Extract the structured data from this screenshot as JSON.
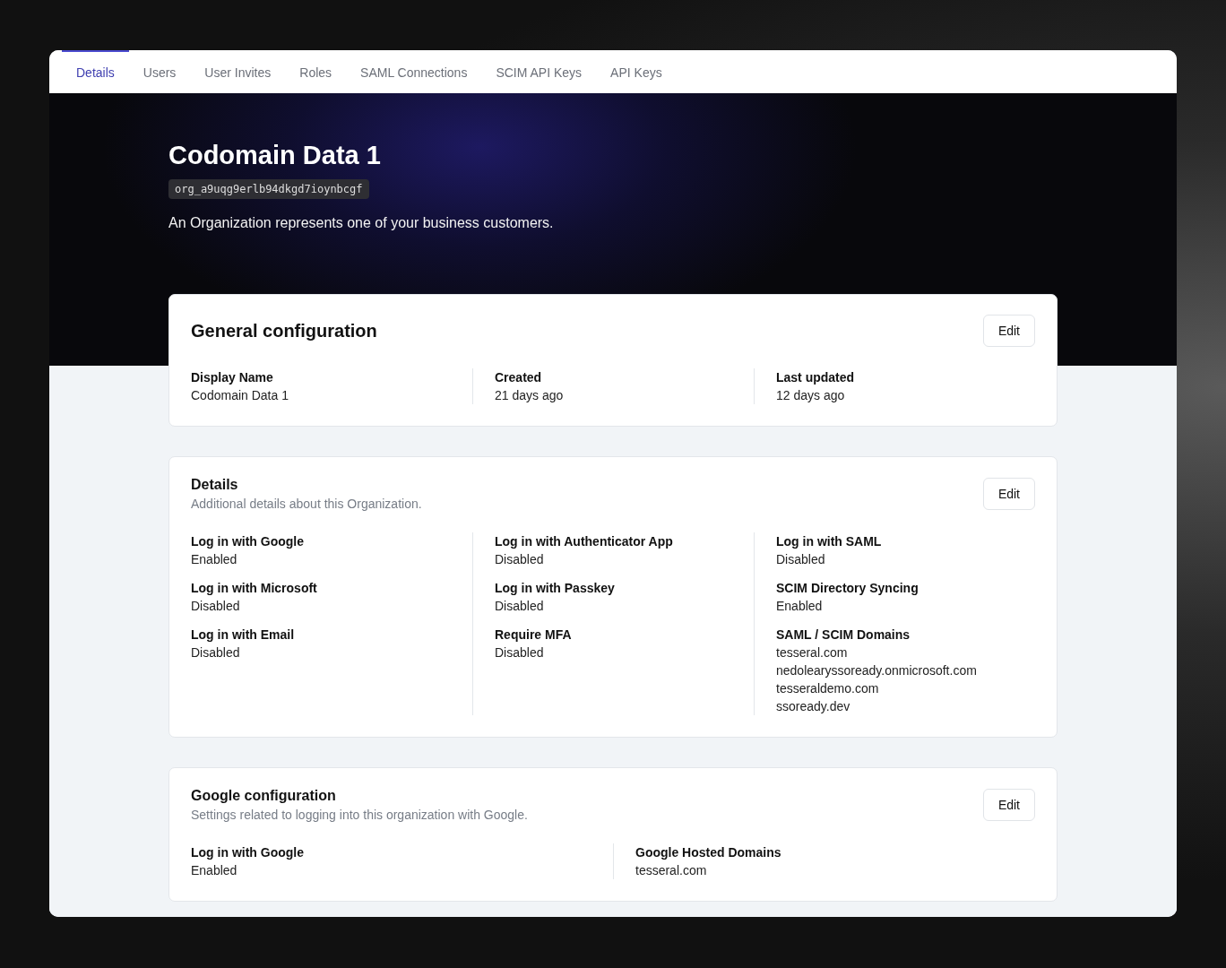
{
  "tabs": [
    {
      "label": "Details",
      "selected": true
    },
    {
      "label": "Users",
      "selected": false
    },
    {
      "label": "User Invites",
      "selected": false
    },
    {
      "label": "Roles",
      "selected": false
    },
    {
      "label": "SAML Connections",
      "selected": false
    },
    {
      "label": "SCIM API Keys",
      "selected": false
    },
    {
      "label": "API Keys",
      "selected": false
    }
  ],
  "header": {
    "title": "Codomain Data 1",
    "id": "org_a9uqg9erlb94dkgd7ioynbcgf",
    "description": "An Organization represents one of your business customers."
  },
  "cards": [
    {
      "kind": "primary",
      "title": "General configuration",
      "button": "Edit",
      "columns": [
        [
          {
            "label": "Display Name",
            "values": [
              "Codomain Data 1"
            ]
          }
        ],
        [
          {
            "label": "Created",
            "values": [
              "21 days ago"
            ]
          }
        ],
        [
          {
            "label": "Last updated",
            "values": [
              "12 days ago"
            ]
          }
        ]
      ]
    },
    {
      "kind": "section",
      "title": "Details",
      "description": "Additional details about this Organization.",
      "button": "Edit",
      "columns": [
        [
          {
            "label": "Log in with Google",
            "values": [
              "Enabled"
            ]
          },
          {
            "label": "Log in with Microsoft",
            "values": [
              "Disabled"
            ]
          },
          {
            "label": "Log in with Email",
            "values": [
              "Disabled"
            ]
          }
        ],
        [
          {
            "label": "Log in with Authenticator App",
            "values": [
              "Disabled"
            ]
          },
          {
            "label": "Log in with Passkey",
            "values": [
              "Disabled"
            ]
          },
          {
            "label": "Require MFA",
            "values": [
              "Disabled"
            ]
          }
        ],
        [
          {
            "label": "Log in with SAML",
            "values": [
              "Disabled"
            ]
          },
          {
            "label": "SCIM Directory Syncing",
            "values": [
              "Enabled"
            ]
          },
          {
            "label": "SAML / SCIM Domains",
            "values": [
              "tesseral.com",
              "nedolearyssoready.onmicrosoft.com",
              "tesseraldemo.com",
              "ssoready.dev"
            ]
          }
        ]
      ]
    },
    {
      "kind": "section",
      "title": "Google configuration",
      "description": "Settings related to logging into this organization with Google.",
      "button": "Edit",
      "columns": [
        [
          {
            "label": "Log in with Google",
            "values": [
              "Enabled"
            ]
          }
        ],
        [
          {
            "label": "Google Hosted Domains",
            "values": [
              "tesseral.com"
            ]
          }
        ]
      ]
    }
  ]
}
